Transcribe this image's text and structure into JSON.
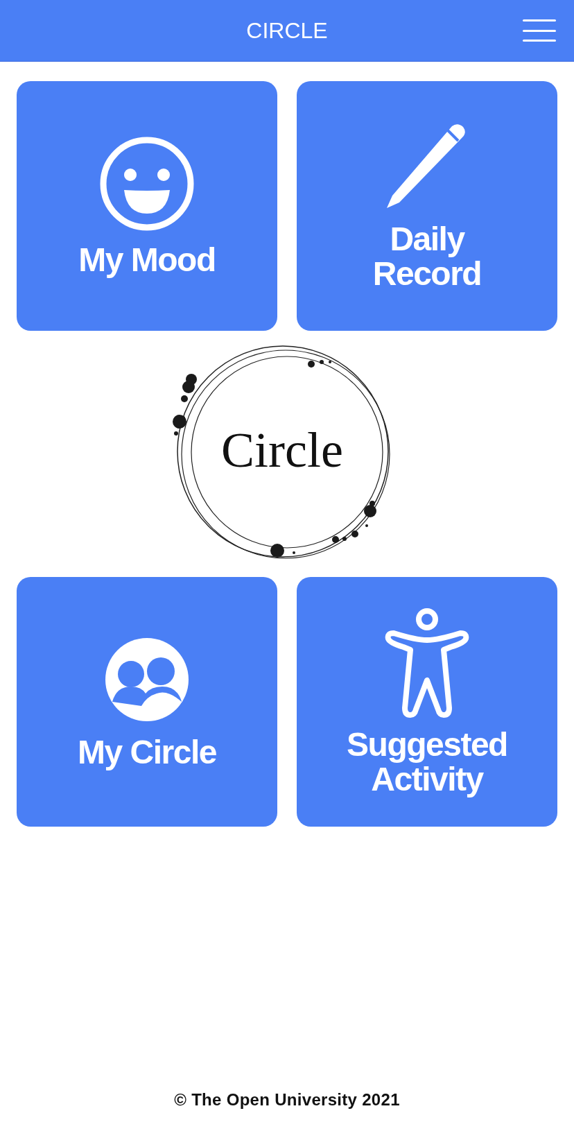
{
  "header": {
    "title": "CIRCLE"
  },
  "top_tiles": [
    {
      "kind": "mood",
      "label": "My Mood"
    },
    {
      "kind": "record",
      "label": "Daily Record"
    }
  ],
  "logo": {
    "text": "Circle"
  },
  "bottom_tiles": [
    {
      "kind": "circle",
      "label": "My Circle"
    },
    {
      "kind": "activity",
      "label": "Suggested Activity"
    }
  ],
  "footer": {
    "text": "© The Open University 2021"
  }
}
